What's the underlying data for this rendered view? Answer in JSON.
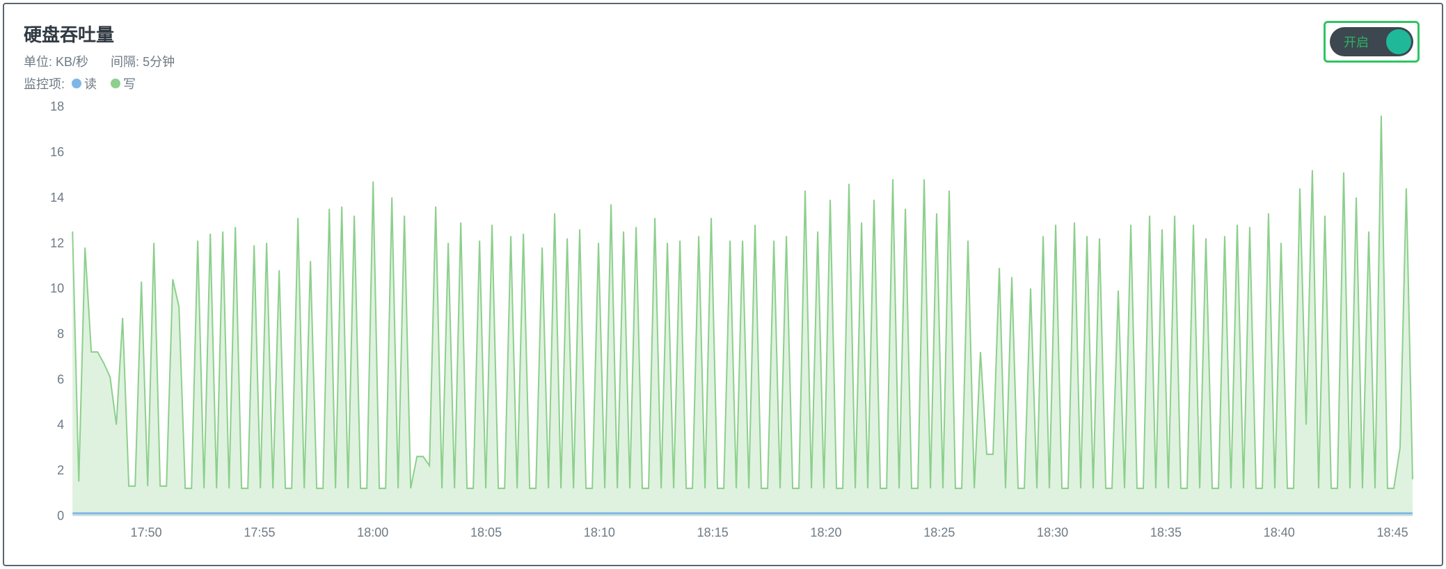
{
  "title": "硬盘吞吐量",
  "unit_label": "单位:",
  "unit_value": "KB/秒",
  "interval_label": "间隔:",
  "interval_value": "5分钟",
  "legend_label": "监控项:",
  "legend": {
    "read": "读",
    "write": "写"
  },
  "toggle_label": "开启",
  "colors": {
    "read": "#7eb6e8",
    "write": "#8dcf8d",
    "toggle_accent": "#1fb999",
    "border_accent": "#2fc462"
  },
  "chart_data": {
    "type": "area",
    "xlabel": "",
    "ylabel": "",
    "ylim": [
      0,
      18
    ],
    "y_ticks": [
      0,
      2,
      4,
      6,
      8,
      10,
      12,
      14,
      16,
      18
    ],
    "x_ticks": [
      "17:50",
      "17:55",
      "18:00",
      "18:05",
      "18:10",
      "18:15",
      "18:20",
      "18:25",
      "18:30",
      "18:35",
      "18:40",
      "18:45"
    ],
    "x_start": "17:46",
    "x_end": "18:47",
    "series": [
      {
        "name": "写",
        "values": [
          12.5,
          1.5,
          11.8,
          7.2,
          7.2,
          6.7,
          6.1,
          4.0,
          8.7,
          1.3,
          1.3,
          10.3,
          1.3,
          12.0,
          1.3,
          1.3,
          10.4,
          9.2,
          1.2,
          1.2,
          12.1,
          1.2,
          12.4,
          1.2,
          12.5,
          1.2,
          12.7,
          1.2,
          1.2,
          11.9,
          1.2,
          12.0,
          1.2,
          10.8,
          1.2,
          1.2,
          13.1,
          1.2,
          11.2,
          1.2,
          1.2,
          13.5,
          1.2,
          13.6,
          1.2,
          13.2,
          1.2,
          1.2,
          14.7,
          1.2,
          1.2,
          14.0,
          1.2,
          13.2,
          1.2,
          2.6,
          2.6,
          2.2,
          13.6,
          1.2,
          12.0,
          1.2,
          12.9,
          1.2,
          1.2,
          12.1,
          1.2,
          12.8,
          1.2,
          1.2,
          12.3,
          1.2,
          12.4,
          1.2,
          1.2,
          11.8,
          1.2,
          13.3,
          1.2,
          12.2,
          1.2,
          12.6,
          1.2,
          1.2,
          12.0,
          1.2,
          13.7,
          1.2,
          12.5,
          1.2,
          12.7,
          1.2,
          1.2,
          13.1,
          1.2,
          12.0,
          1.2,
          12.1,
          1.2,
          1.2,
          12.3,
          1.2,
          13.1,
          1.2,
          1.2,
          12.1,
          1.2,
          12.1,
          1.2,
          12.8,
          1.2,
          1.2,
          12.1,
          1.2,
          12.3,
          1.2,
          1.2,
          14.3,
          1.2,
          12.5,
          1.2,
          13.9,
          1.2,
          1.2,
          14.6,
          1.2,
          12.9,
          1.2,
          13.9,
          1.2,
          1.2,
          14.8,
          1.2,
          13.5,
          1.2,
          1.2,
          14.8,
          1.2,
          13.3,
          1.2,
          14.3,
          1.2,
          1.2,
          12.1,
          1.2,
          7.2,
          2.7,
          2.7,
          10.9,
          1.2,
          10.5,
          1.2,
          1.2,
          10.0,
          1.2,
          12.3,
          1.2,
          12.8,
          1.2,
          1.2,
          12.9,
          1.2,
          12.3,
          1.2,
          12.2,
          1.2,
          1.2,
          9.9,
          1.2,
          12.8,
          1.2,
          1.2,
          13.2,
          1.2,
          12.6,
          1.2,
          13.2,
          1.2,
          1.2,
          12.8,
          1.2,
          12.2,
          1.2,
          1.2,
          12.3,
          1.2,
          12.8,
          1.2,
          12.7,
          1.2,
          1.2,
          13.3,
          1.2,
          12.0,
          1.2,
          1.2,
          14.4,
          4.0,
          15.2,
          1.2,
          13.2,
          1.2,
          1.2,
          15.1,
          1.2,
          14.0,
          1.2,
          12.5,
          1.2,
          17.6,
          1.2,
          1.2,
          3.0,
          14.4,
          1.6
        ]
      },
      {
        "name": "读",
        "values_constant": 0.1
      }
    ]
  }
}
